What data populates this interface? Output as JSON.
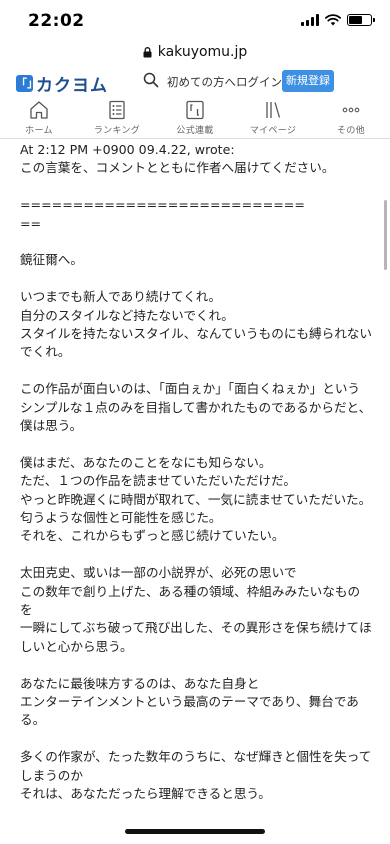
{
  "status_bar": {
    "time": "22:02"
  },
  "browser": {
    "url": "kakuyomu.jp"
  },
  "header": {
    "logo_mark": "「」",
    "logo_text": "カクヨム",
    "beginners_link": "初めての方へ",
    "login_link": "ログイン",
    "signup_button": "新規登録"
  },
  "nav": {
    "tabs": [
      {
        "label": "ホーム",
        "icon": "home-icon"
      },
      {
        "label": "ランキング",
        "icon": "ranking-list-icon"
      },
      {
        "label": "公式連載",
        "icon": "bracket-book-icon"
      },
      {
        "label": "マイページ",
        "icon": "mypage-shelf-icon"
      },
      {
        "label": "その他",
        "icon": "more-dots-icon"
      }
    ]
  },
  "content": {
    "lines": [
      "At 2:12 PM +0900 09.4.22, wrote:",
      "この言葉を、コメントとともに作者へ届けてください。",
      "",
      "===========================",
      "==",
      "",
      "鏡征爾へ。",
      "",
      "いつまでも新人であり続けてくれ。",
      "自分のスタイルなど持たないでくれ。",
      "スタイルを持たないスタイル、なんていうものにも縛られないでくれ。",
      "",
      "この作品が面白いのは、「面白ぇか」「面白くねぇか」という",
      "シンプルな１点のみを目指して書かれたものであるからだと、僕は思う。",
      "",
      "僕はまだ、あなたのことをなにも知らない。",
      "ただ、１つの作品を読ませていただいただけだ。",
      "やっと昨晩遅くに時間が取れて、一気に読ませていただいた。",
      "匂うような個性と可能性を感じた。",
      "それを、これからもずっと感じ続けていたい。",
      "",
      "太田克史、或いは一部の小説界が、必死の思いで",
      "この数年で創り上げた、ある種の領域、枠組みみたいなものを",
      "一瞬にしてぶち破って飛び出した、その異形さを保ち続けてほしいと心から思う。",
      "",
      "あなたに最後味方するのは、あなた自身と",
      "エンターテインメントという最高のテーマであり、舞台である。",
      "",
      "多くの作家が、たった数年のうちに、なぜ輝きと個性を失ってしまうのか",
      "それは、あなただったら理解できると思う。"
    ]
  }
}
